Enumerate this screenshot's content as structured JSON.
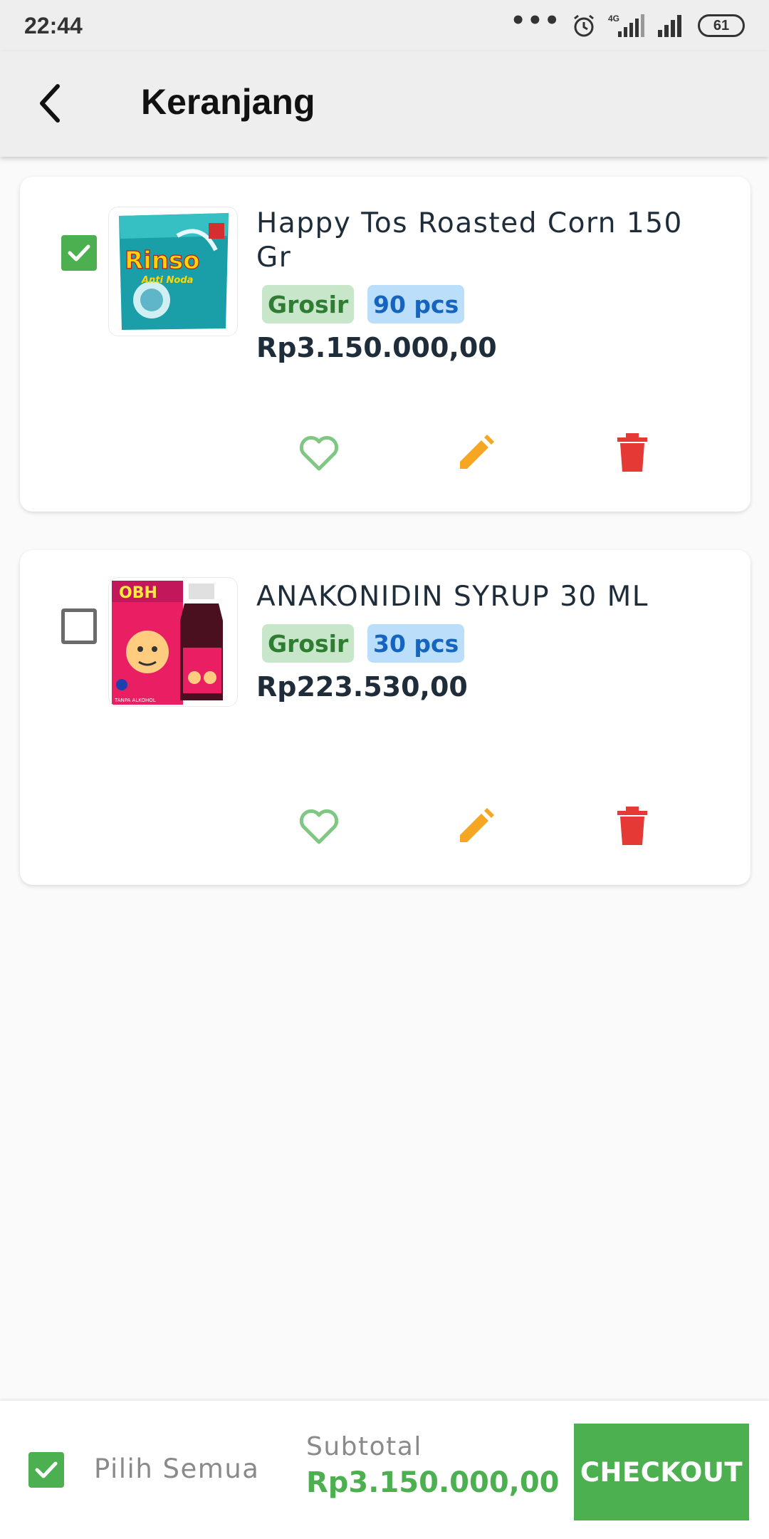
{
  "status_bar": {
    "time": "22:44",
    "network_label": "4G",
    "battery": "61",
    "icons": [
      "more-dots-icon",
      "alarm-icon",
      "signal-4g-icon",
      "signal-icon",
      "battery-icon"
    ]
  },
  "app_bar": {
    "title": "Keranjang",
    "back_icon": "back-arrow-icon"
  },
  "cart": {
    "items": [
      {
        "name": "Happy Tos Roasted Corn 150 Gr",
        "checked": true,
        "image": "Rinso detergent package",
        "image_text": "Rinso",
        "image_subtext": "Anti Noda",
        "type_badge": "Grosir",
        "qty_badge": "90 pcs",
        "price": "Rp3.150.000,00",
        "actions": [
          "heart-icon",
          "edit-icon",
          "delete-icon"
        ]
      },
      {
        "name": "ANAKONIDIN SYRUP 30 ML",
        "checked": false,
        "image": "OBH syrup box and bottle",
        "image_text": "OBH",
        "image_subtext": "TANPA ALKOHOL",
        "type_badge": "Grosir",
        "qty_badge": "30 pcs",
        "price": "Rp223.530,00",
        "actions": [
          "heart-icon",
          "edit-icon",
          "delete-icon"
        ]
      }
    ]
  },
  "bottom_bar": {
    "select_all_checked": true,
    "select_all_label": "Pilih Semua",
    "subtotal_label": "Subtotal",
    "subtotal_value": "Rp3.150.000,00",
    "checkout_label": "CHECKOUT"
  },
  "colors": {
    "primary_green": "#4caf50",
    "edit_orange": "#f5a623",
    "delete_red": "#e53935",
    "heart_green": "#81c784"
  }
}
